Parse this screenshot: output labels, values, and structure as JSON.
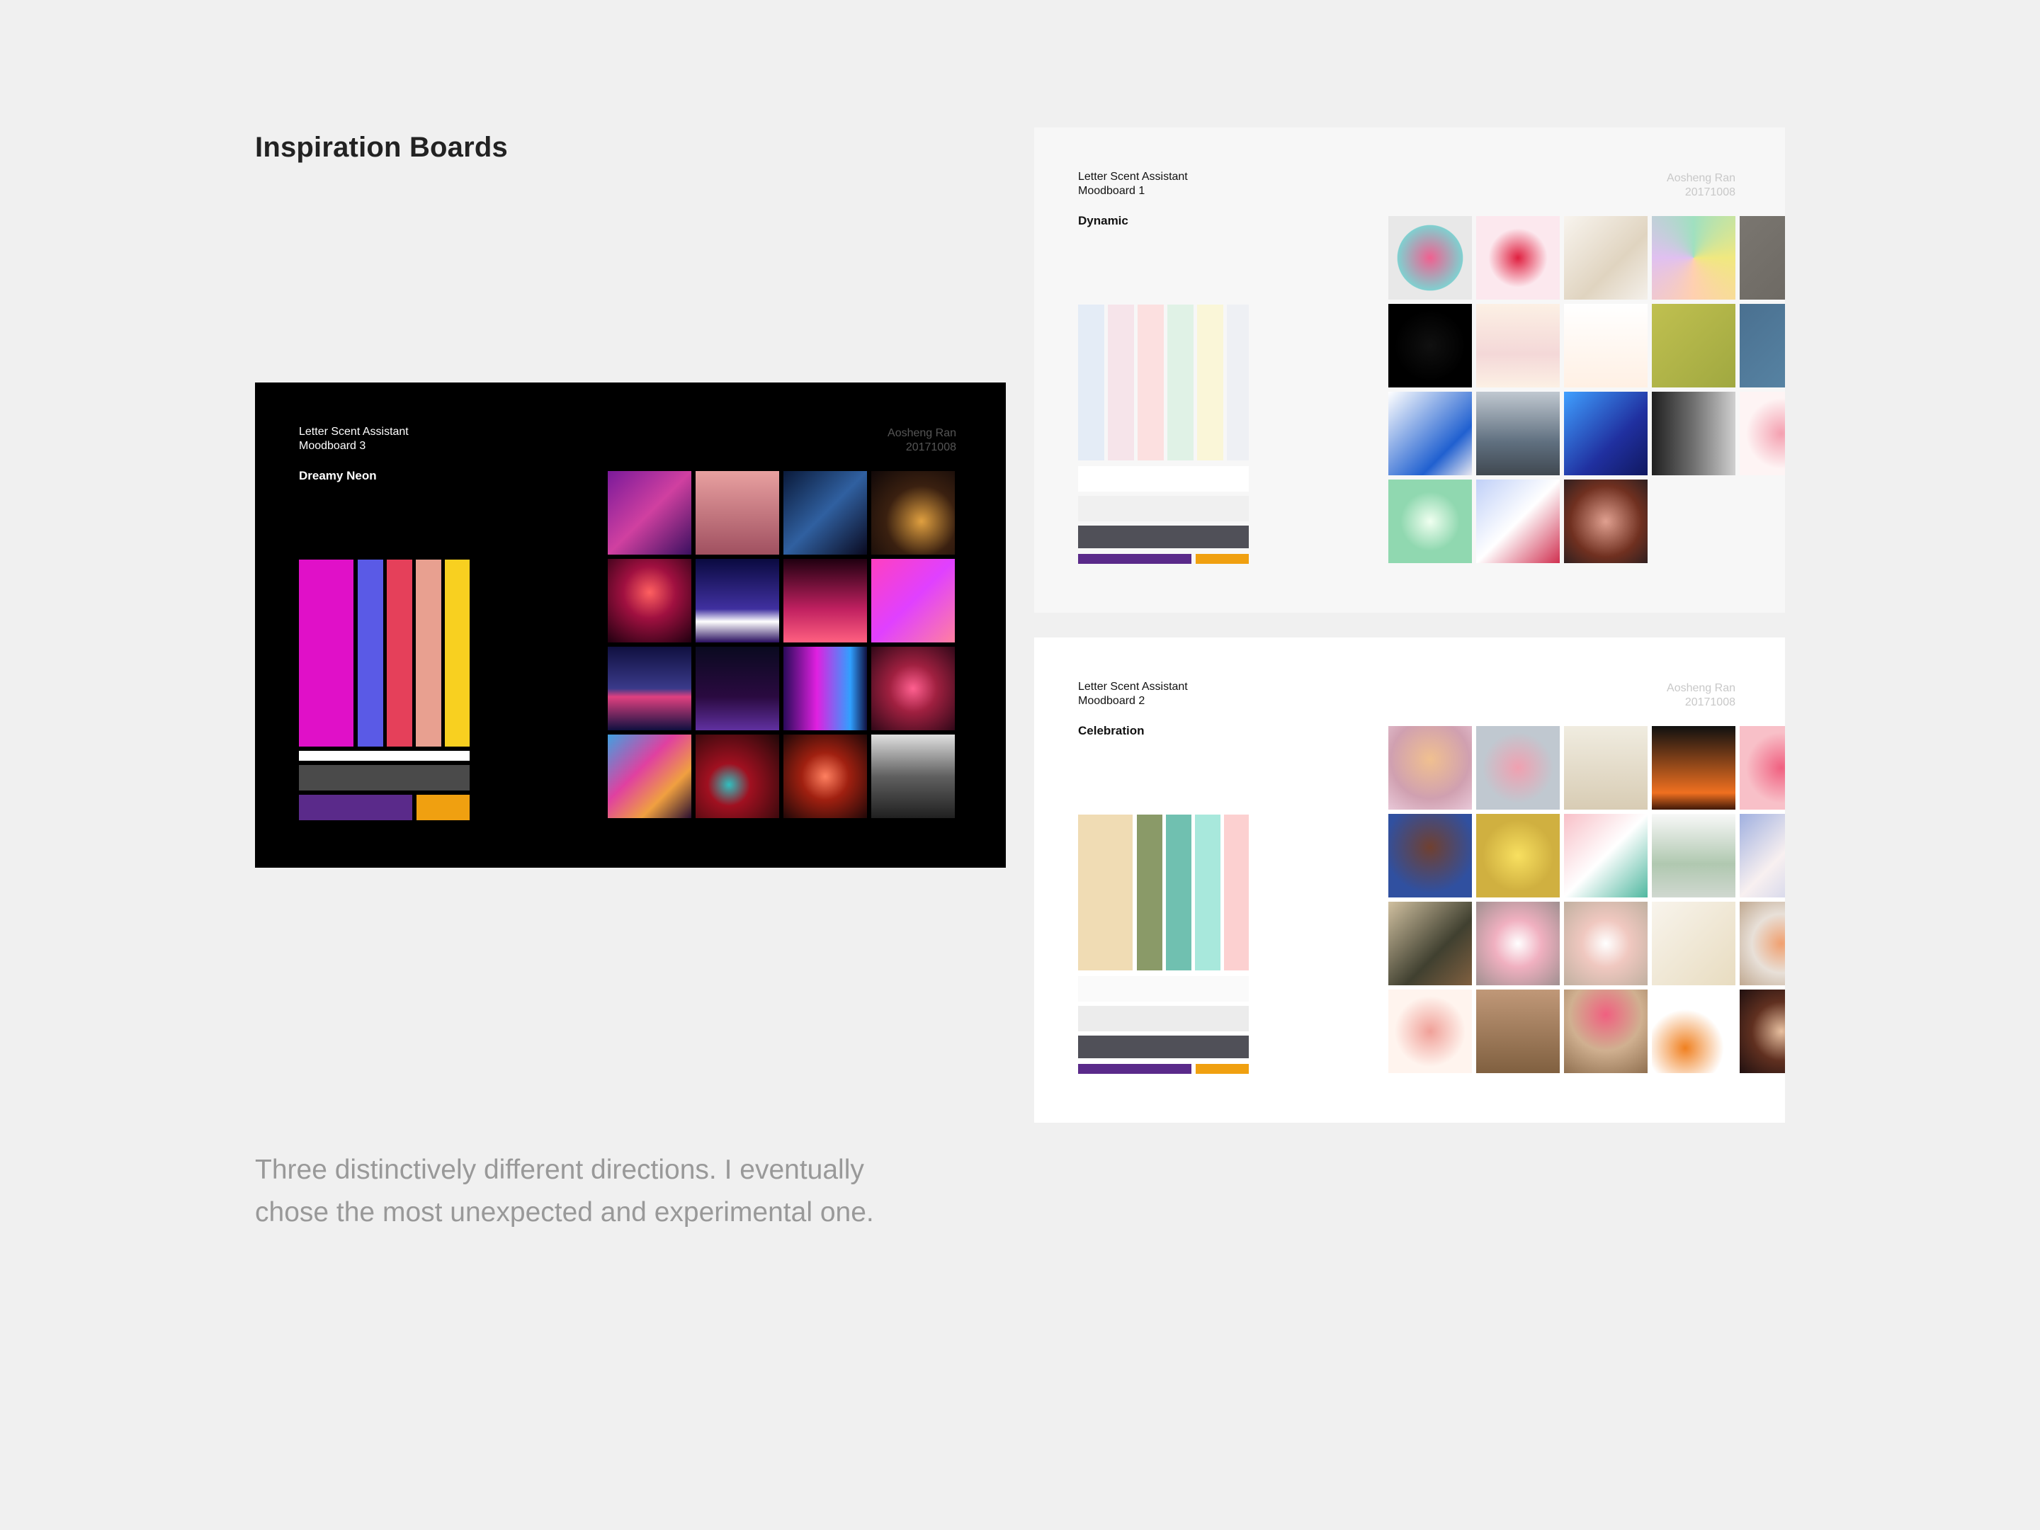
{
  "page_title": "Inspiration Boards",
  "caption": "Three distinctively different directions. I eventually chose the most unexpected and experimental one.",
  "boards": {
    "neon": {
      "app": "Letter Scent Assistant",
      "number": "Moodboard 3",
      "name": "Dreamy Neon",
      "author": "Aosheng Ran",
      "date": "20171008",
      "palette": [
        "#e010c8",
        "#5a5ae6",
        "#e5405a",
        "#e8a090",
        "#f8d020",
        "#ffffff",
        "#4a4a4a",
        "#5a2a8a",
        "#f0a010"
      ],
      "tiles": [
        "linear-gradient(135deg,#7a1a9a,#d040a0 50%,#3a1060)",
        "linear-gradient(180deg,#e8a0a0,#a05060)",
        "linear-gradient(135deg,#0a1a3a,#3060a0 50%,#0a0a20)",
        "radial-gradient(circle at 60% 60%,#e0a040,#3a2010 50%,#100808)",
        "radial-gradient(circle at 50% 40%,#ff6060,#a01040 40%,#200010)",
        "linear-gradient(180deg,#0a0a40,#4030a0 60%,#ffffff 75%,#2a1060)",
        "linear-gradient(180deg,#200010,#c02060 60%,#ff6080)",
        "linear-gradient(135deg,#ff40c0,#e040ff 50%,#ff80a0)",
        "linear-gradient(180deg,#101040,#3a3a8a 50%,#e04080 60%,#101040)",
        "linear-gradient(180deg,#0a0a20,#2a0a40 60%,#6030a0)",
        "linear-gradient(90deg,#2a0a5a,#e020e0 40%,#30a0ff 80%,#101040)",
        "radial-gradient(circle at 50% 50%,#ff6090,#a02040 40%,#300818)",
        "linear-gradient(135deg,#40a0e0,#e040a0 40%,#f0a040 70%,#2a1030)",
        "radial-gradient(circle at 40% 60%,#30c0c0,#a01020 30%,#200808)",
        "radial-gradient(circle at 50% 50%,#ff8060,#a02010 40%,#200808)",
        "linear-gradient(180deg,#e0e0e0,#606060 50%,#202020)"
      ]
    },
    "dynamic": {
      "app": "Letter Scent Assistant",
      "number": "Moodboard 1",
      "name": "Dynamic",
      "author": "Aosheng Ran",
      "date": "20171008",
      "palette": [
        "#e4ecf6",
        "#f6e4ea",
        "#fce0e0",
        "#e0f2e6",
        "#faf6d8",
        "#eef0f4",
        "#ffffff",
        "#f0f0f0",
        "#505058",
        "#5a2a8a",
        "#f0a010"
      ],
      "tiles": [
        "radial-gradient(circle at 50% 50%,#f06090,#80d0d0 55%,#e8e8e8 56%)",
        "radial-gradient(circle at 50% 50%,#e02040,#fce8ee 50%)",
        "linear-gradient(135deg,#f8f4ee,#e0d4c0 60%,#f4f0ea)",
        "conic-gradient(from 0deg,#a0e0c0,#f0e880 25%,#ffd0b0 50%,#e0c0f0 75%,#a0e0c0)",
        "linear-gradient(135deg,#7a7670,#6a6660)",
        "radial-gradient(circle at 50% 50%,#101010,#000 60%)",
        "linear-gradient(180deg,#fcf0e4,#f4d8d8 60%,#fcf0e4)",
        "linear-gradient(180deg,#ffffff,#fff0e4)",
        "linear-gradient(135deg,#c0c050,#a0a840)",
        "linear-gradient(135deg,#4a7090,#5a88a8)",
        "linear-gradient(135deg,#ffffff,#2060d0 70%,#e8e8f0)",
        "linear-gradient(180deg,#c0c8d0,#607080 60%,#404850)",
        "linear-gradient(135deg,#40a0ff,#2030a0 60%,#101860)",
        "linear-gradient(90deg,#202020,#707070 50%,#d0d0d0)",
        "radial-gradient(circle at 50% 50%,#f4a0b0,#fef4f4 60%)",
        "radial-gradient(circle at 50% 50%,#f0fff0,#90d8b0 50%)",
        "linear-gradient(135deg,#c0d0f8,#ffffff 50%,#d03050)",
        "radial-gradient(circle at 50% 50%,#e0a090,#703020 60%,#302020)"
      ]
    },
    "celebration": {
      "app": "Letter Scent Assistant",
      "number": "Moodboard 2",
      "name": "Celebration",
      "author": "Aosheng Ran",
      "date": "20171008",
      "palette": [
        "#f0dcb4",
        "#8a9a68",
        "#70c0b0",
        "#a8e8dc",
        "#fcd0d0",
        "#fafafa",
        "#ececec",
        "#505058",
        "#5a2a8a",
        "#f0a010"
      ],
      "tiles": [
        "radial-gradient(circle at 50% 40%,#f0c090,#d0a0b0 60%,#e8c8d8)",
        "radial-gradient(circle at 50% 50%,#f0a0b0,#c0c8d0 60%)",
        "linear-gradient(180deg,#f0ece0,#d8ccb4)",
        "linear-gradient(180deg,#101010,#f07020 80%,#401808)",
        "radial-gradient(circle at 50% 50%,#f06080,#f8c0c8 60%)",
        "radial-gradient(circle at 50% 40%,#704030,#3050a0 70%)",
        "radial-gradient(circle at 50% 50%,#f8e060,#d0b040 60%)",
        "linear-gradient(135deg,#f8c0c8,#ffffff 50%,#50b8a0)",
        "linear-gradient(180deg,#f8f8f8,#b0c8b0 60%,#d0d8d0)",
        "linear-gradient(135deg,#a0b0e0,#f8f0f0 50%,#c0c8e8)",
        "linear-gradient(135deg,#d0c0a0,#404030 60%,#806040)",
        "radial-gradient(circle at 50% 50%,#ffffff,#f0b0c0 40%,#a09090)",
        "radial-gradient(circle at 50% 50%,#ffffff,#f0c8c0 40%,#c0b0a0)",
        "linear-gradient(135deg,#f8f4ec,#e8dcc0)",
        "radial-gradient(circle at 50% 50%,#f0a070,#e8e0d8 50%,#c0a890)",
        "radial-gradient(circle at 50% 50%,#f0a098,#fff4ee 60%)",
        "linear-gradient(180deg,#c09878,#806040)",
        "radial-gradient(circle at 50% 30%,#f06080,#d0b090 50%,#907050)",
        "radial-gradient(circle at 40% 70%,#f08020,#ffffff 50%)",
        "radial-gradient(circle at 50% 50%,#e8c0a0,#603020 50%,#201010)"
      ]
    }
  }
}
